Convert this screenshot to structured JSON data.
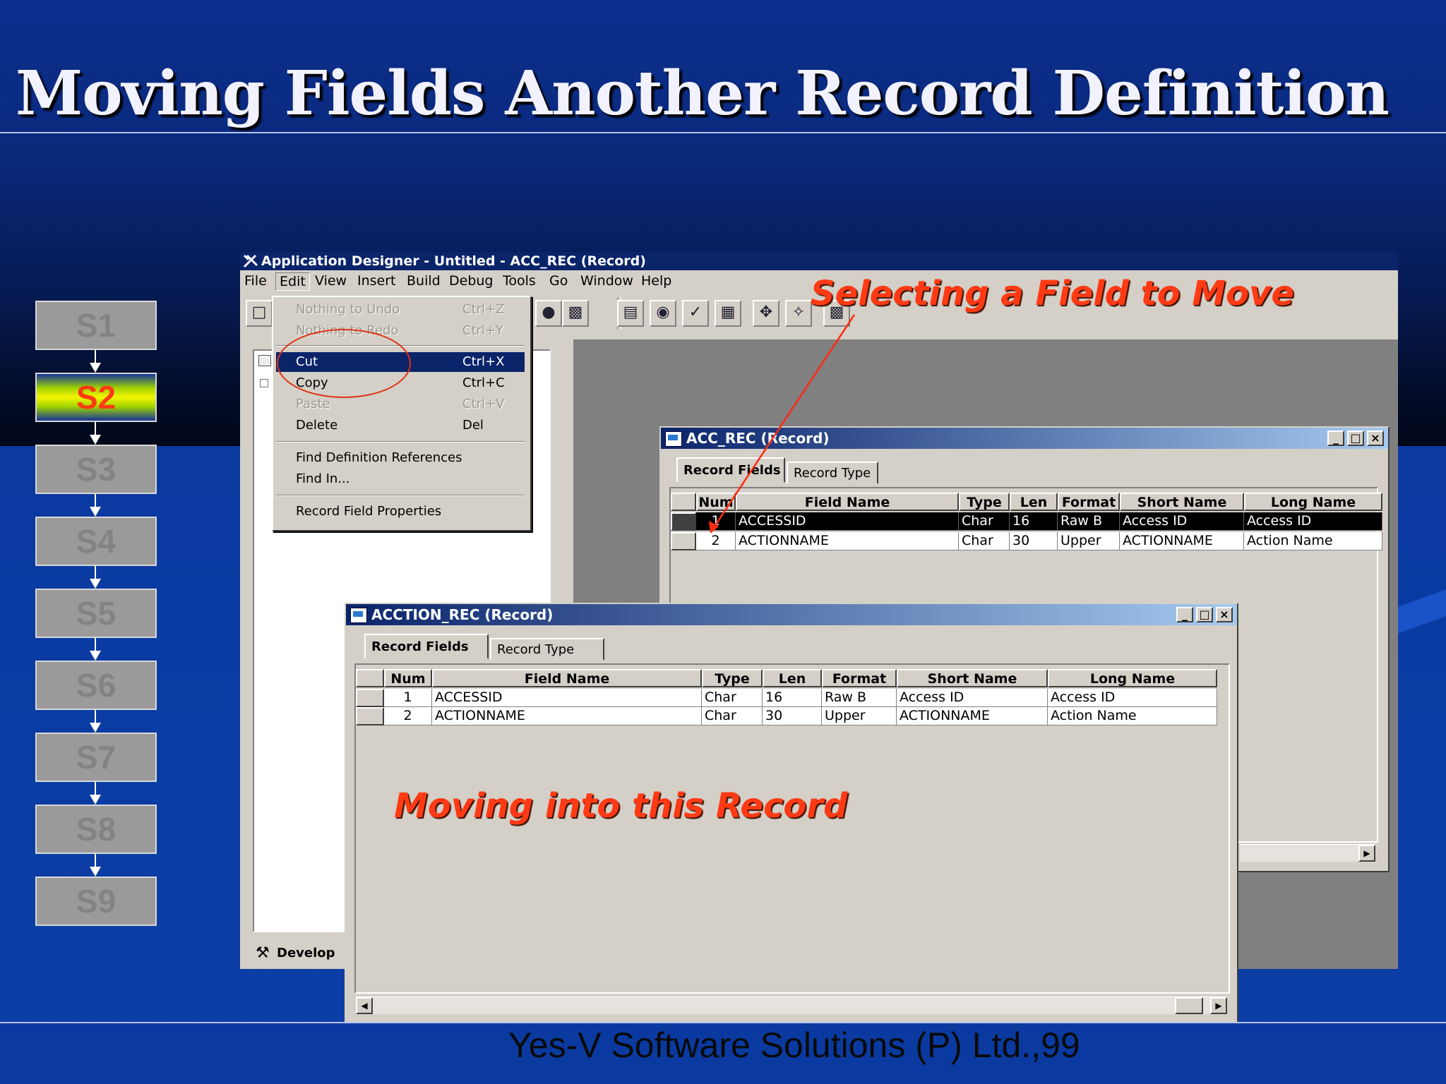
{
  "slide": {
    "title": "Moving Fields Another Record Definition",
    "footer": "Yes-V Software Solutions (P) Ltd.,99",
    "steps": [
      "S1",
      "S2",
      "S3",
      "S4",
      "S5",
      "S6",
      "S7",
      "S8",
      "S9"
    ],
    "active_step": "S2"
  },
  "app": {
    "title": "Application Designer - Untitled - ACC_REC (Record)",
    "menus": [
      "File",
      "Edit",
      "View",
      "Insert",
      "Build",
      "Debug",
      "Tools",
      "Go",
      "Window",
      "Help"
    ],
    "open_menu": "Edit",
    "project_footer": "Develop"
  },
  "edit_menu": {
    "items": [
      {
        "label": "Nothing to Undo",
        "shortcut": "Ctrl+Z",
        "state": "disabled"
      },
      {
        "label": "Nothing to Redo",
        "shortcut": "Ctrl+Y",
        "state": "disabled"
      },
      {
        "label": "Cut",
        "shortcut": "Ctrl+X",
        "state": "highlighted"
      },
      {
        "label": "Copy",
        "shortcut": "Ctrl+C",
        "state": "enabled"
      },
      {
        "label": "Paste",
        "shortcut": "Ctrl+V",
        "state": "disabled"
      },
      {
        "label": "Delete",
        "shortcut": "Del",
        "state": "enabled"
      },
      {
        "label": "Find Definition References",
        "shortcut": "",
        "state": "enabled"
      },
      {
        "label": "Find In...",
        "shortcut": "",
        "state": "enabled"
      },
      {
        "label": "Record Field Properties",
        "shortcut": "",
        "state": "enabled"
      }
    ]
  },
  "acc_rec": {
    "title": "ACC_REC (Record)",
    "tabs": [
      "Record Fields",
      "Record Type"
    ],
    "columns": [
      "Num",
      "Field Name",
      "Type",
      "Len",
      "Format",
      "Short Name",
      "Long Name"
    ],
    "rows": [
      {
        "num": "1",
        "field": "ACCESSID",
        "type": "Char",
        "len": "16",
        "format": "Raw B",
        "short": "Access ID",
        "long": "Access ID",
        "selected": true
      },
      {
        "num": "2",
        "field": "ACTIONNAME",
        "type": "Char",
        "len": "30",
        "format": "Upper",
        "short": "ACTIONNAME",
        "long": "Action Name",
        "selected": false
      }
    ]
  },
  "accction_rec": {
    "title": "ACCTION_REC (Record)",
    "tabs": [
      "Record Fields",
      "Record Type"
    ],
    "columns": [
      "Num",
      "Field Name",
      "Type",
      "Len",
      "Format",
      "Short Name",
      "Long Name"
    ],
    "rows": [
      {
        "num": "1",
        "field": "ACCESSID",
        "type": "Char",
        "len": "16",
        "format": "Raw B",
        "short": "Access ID",
        "long": "Access ID"
      },
      {
        "num": "2",
        "field": "ACTIONNAME",
        "type": "Char",
        "len": "30",
        "format": "Upper",
        "short": "ACTIONNAME",
        "long": "Action Name"
      }
    ]
  },
  "annotations": {
    "selecting": "Selecting a Field to Move",
    "moving": "Moving into this Record"
  },
  "colors": {
    "annotation": "#ff3a14",
    "titlebar": "#0a246a",
    "selection": "#000000"
  }
}
